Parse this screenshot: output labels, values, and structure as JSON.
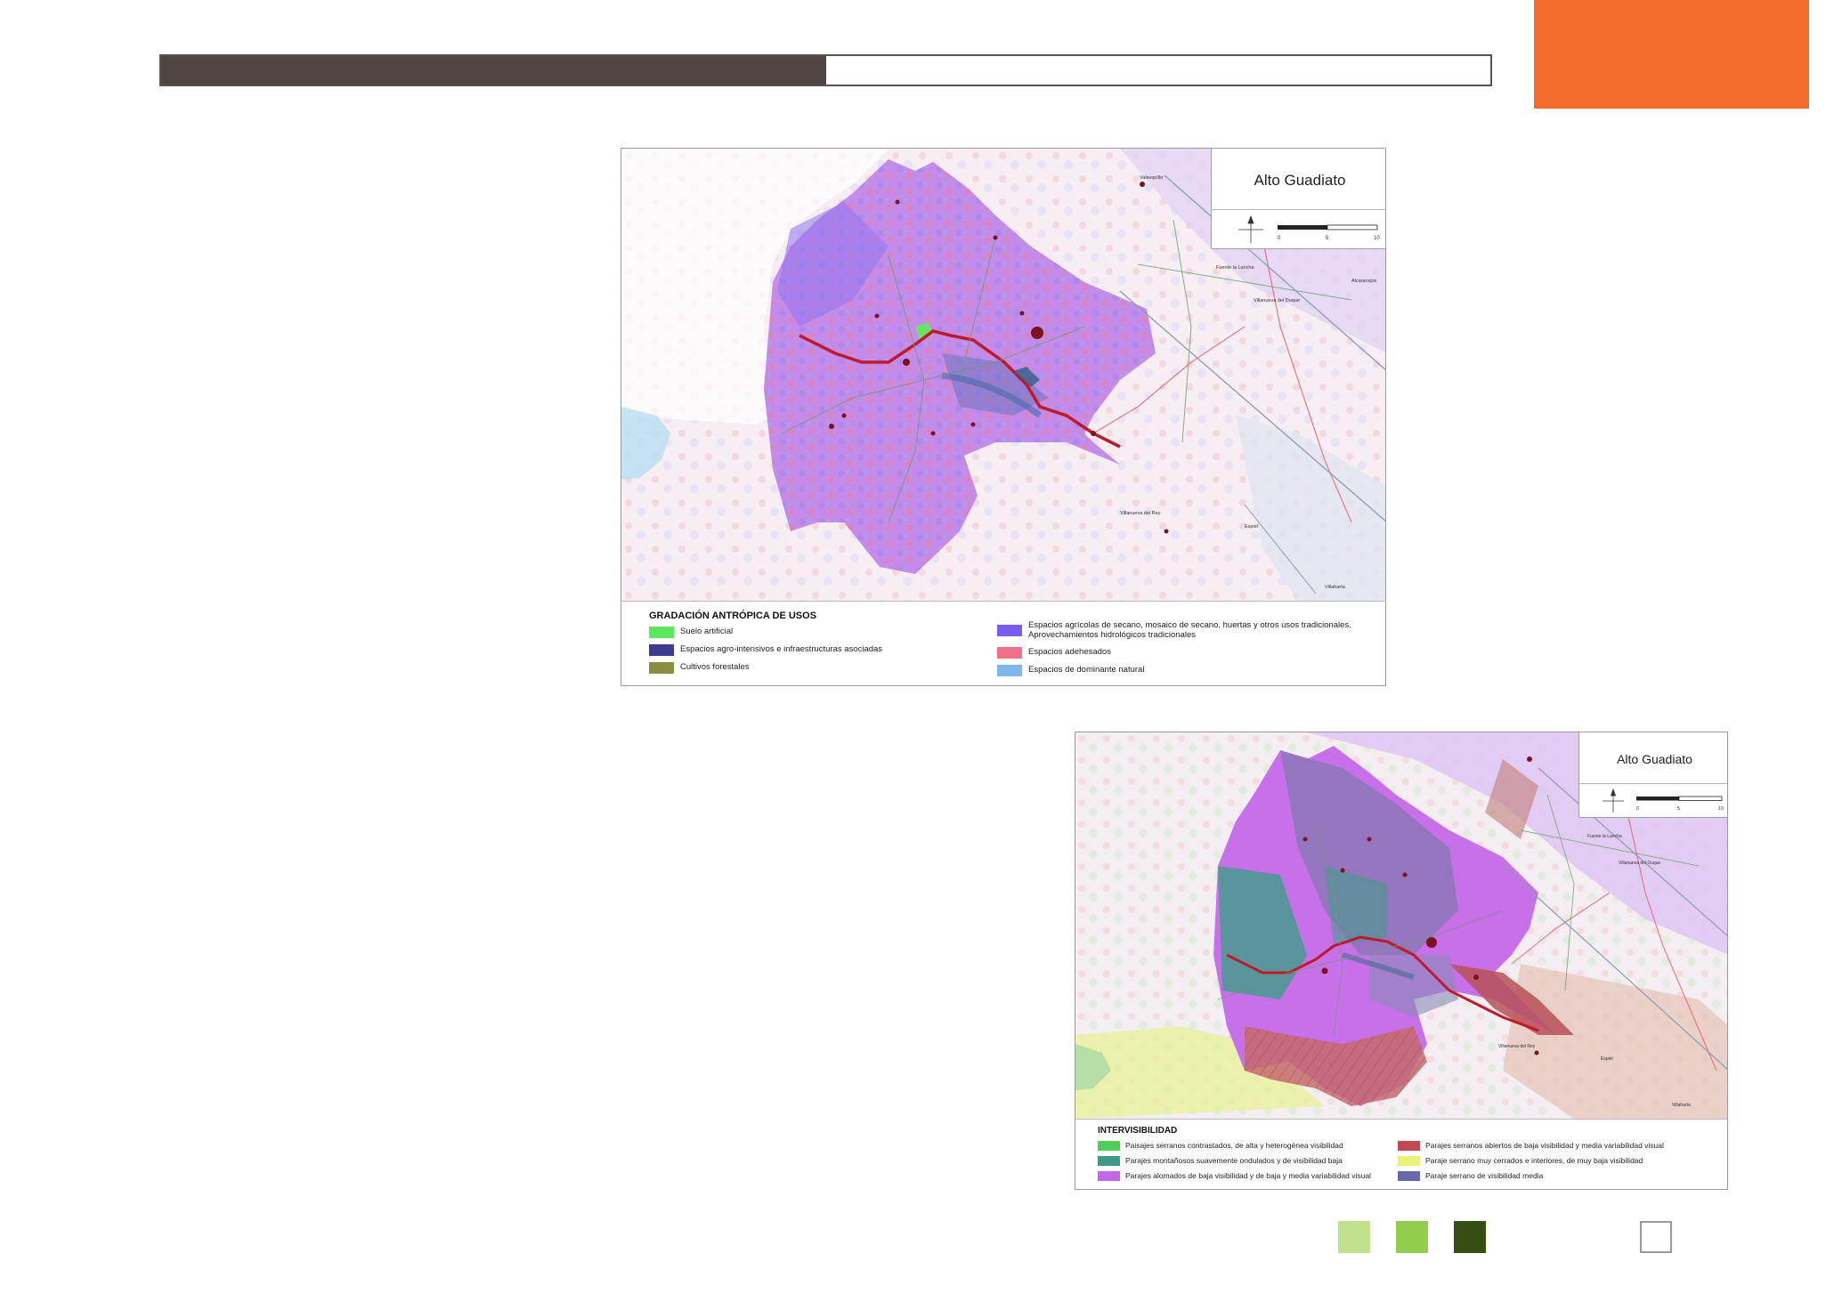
{
  "header": {
    "progress_fraction": 0.5,
    "fill_color": "#4e4642",
    "accent_color": "#f26b2b"
  },
  "maps": [
    {
      "title": "Alto Guadiato",
      "scale_ticks": [
        "0",
        "5",
        "10"
      ],
      "place_labels": [
        "Valsequillo",
        "Fuente la Lancha",
        "Villanueva del Duque",
        "Villanueva del Rey",
        "Espiel",
        "Villaharta",
        "Alcaracejos"
      ],
      "legend": {
        "title": "GRADACIÓN ANTRÓPICA DE USOS",
        "items": [
          {
            "label": "Suelo artificial",
            "color": "#5be85e"
          },
          {
            "label": "Espacios agro-intensivos e infraestructuras asociadas",
            "color": "#3b3b8f"
          },
          {
            "label": "Cultivos forestales",
            "color": "#8a8d44"
          },
          {
            "label": "Espacios agrícolas de secano, mosaico de secano, huertas y otros usos tradicionales. Aprovechamientos hidrológicos tradicionales",
            "color": "#7a5cf0"
          },
          {
            "label": "Espacios adehesados",
            "color": "#f07088"
          },
          {
            "label": "Espacios de dominante natural",
            "color": "#7fb6ec"
          }
        ]
      }
    },
    {
      "title": "Alto Guadiato",
      "scale_ticks": [
        "0",
        "5",
        "10"
      ],
      "place_labels": [
        "Fuente la Lancha",
        "Villanueva del Duque",
        "Villanueva del Rey",
        "Espiel",
        "Villaharta"
      ],
      "legend": {
        "title": "INTERVISIBILIDAD",
        "items": [
          {
            "label": "Paisajes serranos contrastados, de alta y heterogénea visibilidad",
            "color": "#4fcf57"
          },
          {
            "label": "Parajes montañosos suavemente ondulados y de visibilidad baja",
            "color": "#3d9a86"
          },
          {
            "label": "Parajes alomados de baja visibilidad y de baja y media variabilidad visual",
            "color": "#c266ea"
          },
          {
            "label": "Parajes serranos abiertos de baja visibilidad y media variabilidad visual",
            "color": "#c04a52"
          },
          {
            "label": "Paraje serrano muy cerrados e interiores, de muy baja visibilidad",
            "color": "#e9f27a"
          },
          {
            "label": "Paraje serrano de visibilidad media",
            "color": "#6868a8"
          }
        ]
      }
    }
  ],
  "footer_squares": [
    {
      "name": "light-green",
      "color": "#c0e08e"
    },
    {
      "name": "green",
      "color": "#92ce4c"
    },
    {
      "name": "dark-green",
      "color": "#354f13"
    },
    {
      "name": "empty",
      "color": "#ffffff"
    }
  ]
}
